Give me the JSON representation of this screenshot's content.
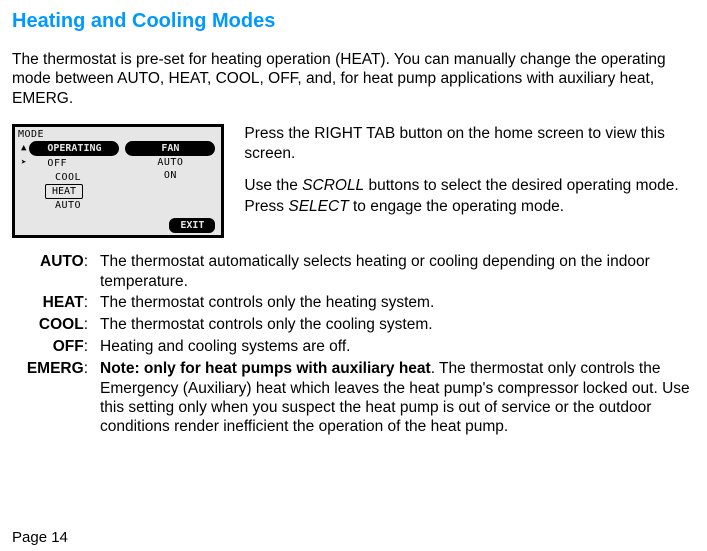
{
  "title": "Heating and Cooling Modes",
  "intro": "The thermostat is pre-set for heating operation (HEAT). You can manually change the operating mode between AUTO, HEAT, COOL, OFF, and, for heat pump applications with auxiliary heat, EMERG.",
  "lcd": {
    "mode_label": "MODE",
    "operating": "OPERATING",
    "off": "OFF",
    "cool": "COOL",
    "heat": "HEAT",
    "auto": "AUTO",
    "fan": "FAN",
    "fan_auto": "AUTO",
    "fan_on": "ON",
    "exit": "EXIT"
  },
  "figtext": {
    "line1": "Press the RIGHT TAB button on the home screen to view this screen.",
    "line2a": "Use the ",
    "scroll": "SCROLL",
    "line2b": " buttons to select the desired operating mode. Press ",
    "select": "SELECT",
    "line2c": " to engage the operating mode."
  },
  "defs": {
    "auto": {
      "term": "AUTO",
      "body": "The thermostat automatically selects heating or cooling depending on the indoor temperature."
    },
    "heat": {
      "term": "HEAT",
      "body": "The thermostat controls only the heating system."
    },
    "cool": {
      "term": "COOL",
      "body": "The thermostat controls only the cooling system."
    },
    "off": {
      "term": "OFF",
      "body": "Heating and cooling systems are off."
    },
    "emerg": {
      "term": "EMERG",
      "lead": "Note: only for heat pumps with auxiliary heat",
      "rest": ". The thermostat only controls the Emergency (Auxiliary) heat which leaves the heat pump's compressor locked out. Use this setting only when you suspect the heat pump is out of service or the outdoor conditions render inefficient the operation of the heat pump."
    }
  },
  "footer": "Page 14"
}
